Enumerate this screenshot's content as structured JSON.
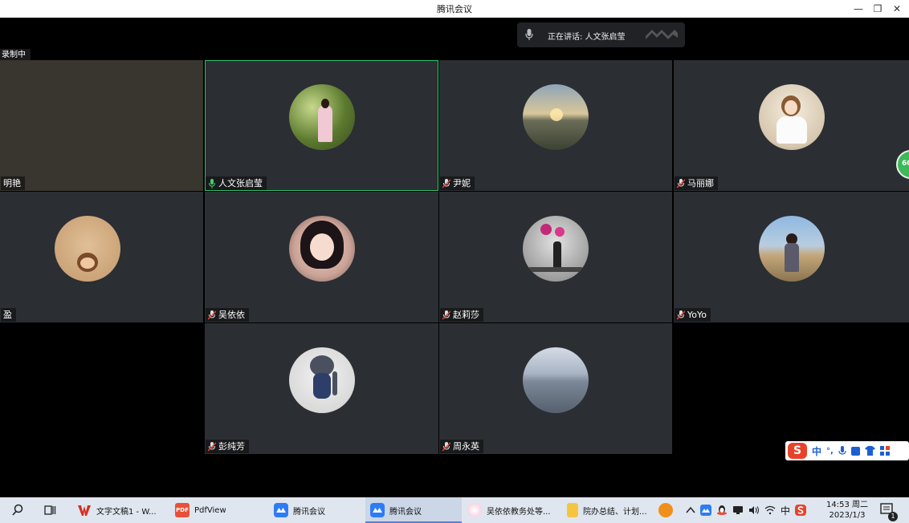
{
  "window": {
    "title": "腾讯会议",
    "minimize": "—",
    "restore": "❐",
    "close": "✕"
  },
  "speaking": {
    "text": "正在讲话: 人文张启莹"
  },
  "recording": {
    "label": "录制中"
  },
  "participants": [
    {
      "name": "明艳"
    },
    {
      "name": "人文张启莹"
    },
    {
      "name": "尹妮"
    },
    {
      "name": "马丽娜"
    },
    {
      "name": "盈"
    },
    {
      "name": "吴依依"
    },
    {
      "name": "赵莉莎"
    },
    {
      "name": "YoYo"
    },
    {
      "name": "彭纯芳"
    },
    {
      "name": "周永英"
    }
  ],
  "side_badge": {
    "text": "60"
  },
  "ime": {
    "lang": "中",
    "punct": "°,"
  },
  "taskbar": {
    "items": [
      {
        "label": "文字文稿1 - W..."
      },
      {
        "label": "PdfView"
      },
      {
        "label": "腾讯会议"
      },
      {
        "label": "腾讯会议"
      },
      {
        "label": "吴依依教务处等..."
      },
      {
        "label": "院办总结、计划..."
      }
    ],
    "tray_lang": "中",
    "time": "14:53 周二",
    "date": "2023/1/3",
    "notification_count": "1"
  },
  "colors": {
    "active_border": "#2ec270",
    "tile_bg": "#2b2e33",
    "taskbar_bg": "#dfe6ef"
  }
}
